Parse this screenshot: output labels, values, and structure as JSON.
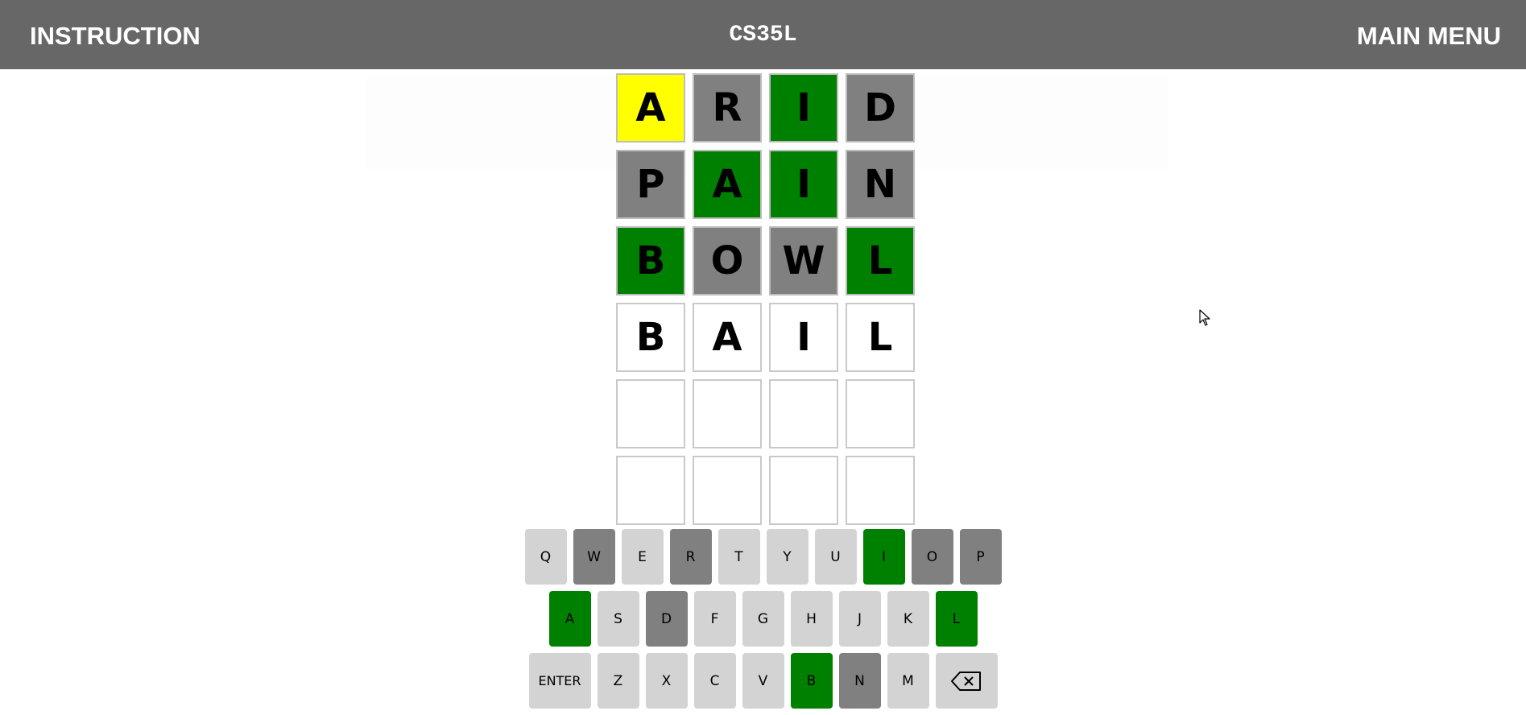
{
  "header": {
    "left_label": "INSTRUCTION",
    "title": "CS35L",
    "right_label": "MAIN MENU"
  },
  "colors": {
    "correct": "#008000",
    "present": "#ffff00",
    "absent": "#808080",
    "unused_key": "#d3d3d3",
    "header_bg": "#676767"
  },
  "board": {
    "rows": [
      [
        {
          "letter": "A",
          "state": "present"
        },
        {
          "letter": "R",
          "state": "absent"
        },
        {
          "letter": "I",
          "state": "correct"
        },
        {
          "letter": "D",
          "state": "absent"
        }
      ],
      [
        {
          "letter": "P",
          "state": "absent"
        },
        {
          "letter": "A",
          "state": "correct"
        },
        {
          "letter": "I",
          "state": "correct"
        },
        {
          "letter": "N",
          "state": "absent"
        }
      ],
      [
        {
          "letter": "B",
          "state": "correct"
        },
        {
          "letter": "O",
          "state": "absent"
        },
        {
          "letter": "W",
          "state": "absent"
        },
        {
          "letter": "L",
          "state": "correct"
        }
      ],
      [
        {
          "letter": "B",
          "state": "typed"
        },
        {
          "letter": "A",
          "state": "typed"
        },
        {
          "letter": "I",
          "state": "typed"
        },
        {
          "letter": "L",
          "state": "typed"
        }
      ],
      [
        {
          "letter": "",
          "state": "empty"
        },
        {
          "letter": "",
          "state": "empty"
        },
        {
          "letter": "",
          "state": "empty"
        },
        {
          "letter": "",
          "state": "empty"
        }
      ],
      [
        {
          "letter": "",
          "state": "empty"
        },
        {
          "letter": "",
          "state": "empty"
        },
        {
          "letter": "",
          "state": "empty"
        },
        {
          "letter": "",
          "state": "empty"
        }
      ]
    ]
  },
  "keyboard": {
    "rows": [
      [
        {
          "label": "Q",
          "state": "unused"
        },
        {
          "label": "W",
          "state": "absent"
        },
        {
          "label": "E",
          "state": "unused"
        },
        {
          "label": "R",
          "state": "absent"
        },
        {
          "label": "T",
          "state": "unused"
        },
        {
          "label": "Y",
          "state": "unused"
        },
        {
          "label": "U",
          "state": "unused"
        },
        {
          "label": "I",
          "state": "correct"
        },
        {
          "label": "O",
          "state": "absent"
        },
        {
          "label": "P",
          "state": "absent"
        }
      ],
      [
        {
          "label": "A",
          "state": "correct"
        },
        {
          "label": "S",
          "state": "unused"
        },
        {
          "label": "D",
          "state": "absent"
        },
        {
          "label": "F",
          "state": "unused"
        },
        {
          "label": "G",
          "state": "unused"
        },
        {
          "label": "H",
          "state": "unused"
        },
        {
          "label": "J",
          "state": "unused"
        },
        {
          "label": "K",
          "state": "unused"
        },
        {
          "label": "L",
          "state": "correct"
        }
      ],
      [
        {
          "label": "ENTER",
          "state": "unused",
          "wide": true
        },
        {
          "label": "Z",
          "state": "unused"
        },
        {
          "label": "X",
          "state": "unused"
        },
        {
          "label": "C",
          "state": "unused"
        },
        {
          "label": "V",
          "state": "unused"
        },
        {
          "label": "B",
          "state": "correct"
        },
        {
          "label": "N",
          "state": "absent"
        },
        {
          "label": "M",
          "state": "unused"
        },
        {
          "label": "",
          "state": "unused",
          "wide": true,
          "icon": "backspace-icon"
        }
      ]
    ]
  }
}
